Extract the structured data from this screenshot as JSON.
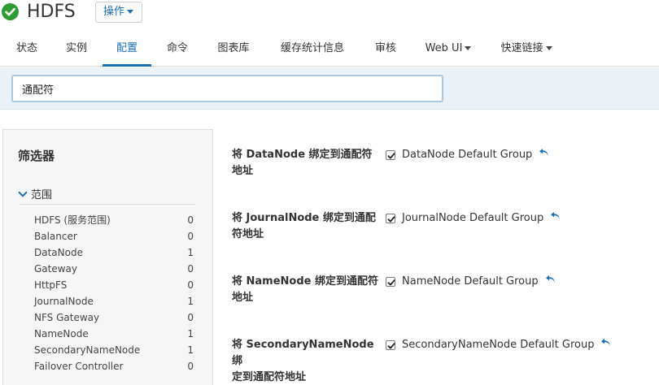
{
  "header": {
    "service_name": "HDFS",
    "actions_label": "操作",
    "status_color": "#2e9a33"
  },
  "tabs": [
    {
      "label": "状态"
    },
    {
      "label": "实例"
    },
    {
      "label": "配置",
      "active": true
    },
    {
      "label": "命令"
    },
    {
      "label": "图表库"
    },
    {
      "label": "缓存统计信息"
    },
    {
      "label": "审核"
    },
    {
      "label": "Web UI",
      "dropdown": true
    },
    {
      "label": "快速链接",
      "dropdown": true
    }
  ],
  "search": {
    "value": "通配符"
  },
  "filters": {
    "title": "筛选器",
    "scope_label": "范围",
    "items": [
      {
        "name": "HDFS (服务范围)",
        "count": "0"
      },
      {
        "name": "Balancer",
        "count": "0"
      },
      {
        "name": "DataNode",
        "count": "1"
      },
      {
        "name": "Gateway",
        "count": "0"
      },
      {
        "name": "HttpFS",
        "count": "0"
      },
      {
        "name": "JournalNode",
        "count": "1"
      },
      {
        "name": "NFS Gateway",
        "count": "0"
      },
      {
        "name": "NameNode",
        "count": "1"
      },
      {
        "name": "SecondaryNameNode",
        "count": "1"
      },
      {
        "name": "Failover Controller",
        "count": "0"
      }
    ]
  },
  "properties": [
    {
      "line1": "将 DataNode 绑定到通配符",
      "line2": "地址",
      "checked": true,
      "group": "DataNode Default Group"
    },
    {
      "line1": "将 JournalNode 绑定到通配",
      "line2": "符地址",
      "checked": true,
      "group": "JournalNode Default Group"
    },
    {
      "line1": "将 NameNode 绑定到通配符",
      "line2": "地址",
      "checked": true,
      "group": "NameNode Default Group"
    },
    {
      "line1": "将 SecondaryNameNode 绑",
      "line2": "定到通配符地址",
      "checked": true,
      "group": "SecondaryNameNode Default Group"
    }
  ],
  "colors": {
    "accent": "#1a6fb5",
    "search_band": "#eaf1f7"
  }
}
